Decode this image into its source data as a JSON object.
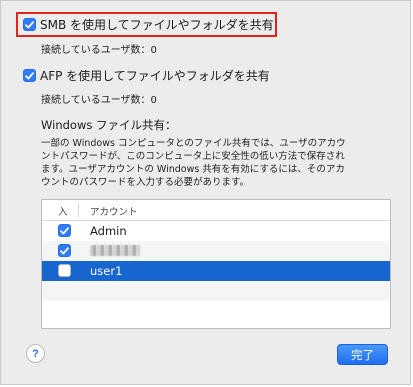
{
  "options": {
    "smb": {
      "label": "SMB を使用してファイルやフォルダを共有",
      "checked": true,
      "connected": "接続しているユーザ数：0"
    },
    "afp": {
      "label": "AFP を使用してファイルやフォルダを共有",
      "checked": true,
      "connected": "接続しているユーザ数：0"
    }
  },
  "windows": {
    "title": "Windows ファイル共有：",
    "description": [
      "一部の Windows コンピュータとのファイル共有では、ユーザのアカウ",
      "ントパスワードが、このコンピュータ上に安全性の低い方法で保存され",
      "ます。ユーザアカウントの Windows 共有を有効にするには、そのアカ",
      "ウントのパスワードを入力する必要があります。"
    ]
  },
  "table": {
    "columns": [
      "入",
      "アカウント"
    ],
    "rows": [
      {
        "account": "Admin",
        "enabled": true,
        "selected": false
      },
      {
        "account": "",
        "enabled": true,
        "selected": false,
        "redacted": true
      },
      {
        "account": "user1",
        "enabled": false,
        "selected": true
      }
    ]
  },
  "buttons": {
    "help": "?",
    "done": "完了"
  },
  "colors": {
    "accent": "#2f7cf6",
    "selection": "#1765cf",
    "highlight": "#e2231a"
  }
}
